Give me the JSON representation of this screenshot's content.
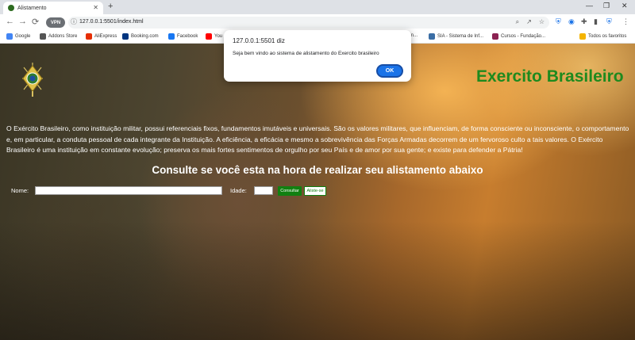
{
  "browser": {
    "tab_title": "Alistamento",
    "tab_close": "✕",
    "new_tab": "+",
    "vpn_label": "VPN",
    "url": "127.0.0.1:5501/index.html",
    "win_min": "—",
    "win_max": "❐",
    "win_close": "✕"
  },
  "bookmarks": [
    {
      "label": "Google",
      "color": "#4285f4"
    },
    {
      "label": "Addons Store",
      "color": "#555555"
    },
    {
      "label": "AliExpress",
      "color": "#e62e04"
    },
    {
      "label": "Booking.com",
      "color": "#003580"
    },
    {
      "label": "Facebook",
      "color": "#1877f2"
    },
    {
      "label": "You",
      "color": "#ff0000"
    },
    {
      "label": "gin...",
      "color": "#777777"
    },
    {
      "label": "SIA - Sistema de Inf...",
      "color": "#3b6ea5"
    },
    {
      "label": "Cursos - Fundação...",
      "color": "#8b2252"
    },
    {
      "label": "Todos os favoritos",
      "color": "#f4b400"
    }
  ],
  "page": {
    "title": "Exercito Brasileiro",
    "intro": "O Exército Brasileiro, como instituição militar, possui referenciais fixos, fundamentos imutáveis e universais. São os valores militares, que influenciam, de forma consciente ou inconsciente, o comportamento e, em particular, a conduta pessoal de cada integrante da Instituição. A eficiência, a eficácia e mesmo a sobrevivência das Forças Armadas decorrem de um fervoroso culto a tais valores. O Exército Brasileiro é uma instituição em constante evolução; preserva os mais fortes sentimentos de orgulho por seu País e de amor por sua gente; e existe para defender a Pátria!",
    "headline": "Consulte se você esta na hora de realizar seu alistamento abaixo",
    "form": {
      "nome_label": "Nome:",
      "nome_value": "",
      "idade_label": "Idade:",
      "idade_value": "",
      "consultar_label": "Consultar",
      "aliste_label": "Aliste-se"
    }
  },
  "dialog": {
    "title": "127.0.0.1:5501 diz",
    "message": "Seja bem vindo ao sistema de alistamento do Exercito brasileiro",
    "ok_label": "OK"
  },
  "colors": {
    "title_green": "#1e8a1e",
    "button_green": "#118011",
    "dialog_ok": "#1a73e8"
  }
}
